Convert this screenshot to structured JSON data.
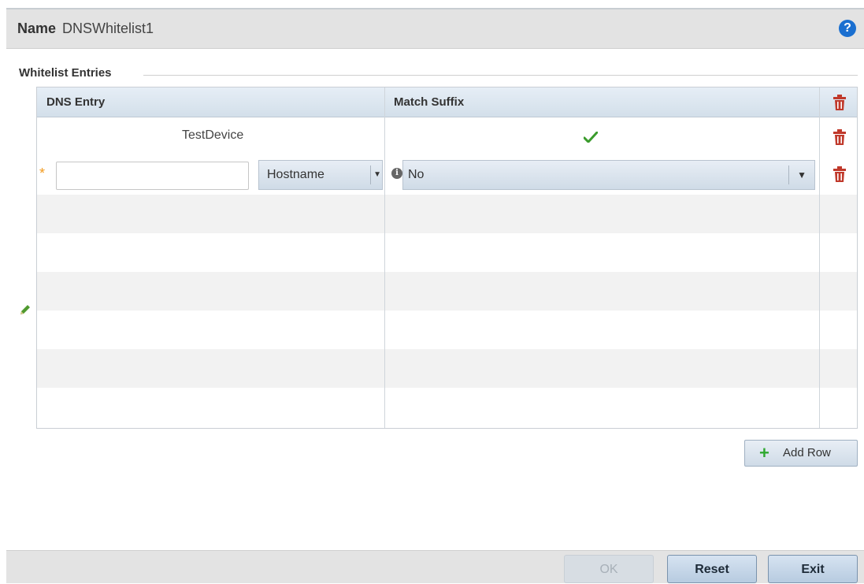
{
  "header": {
    "name_label": "Name",
    "name_value": "DNSWhitelist1",
    "help_icon": "?"
  },
  "section": {
    "title": "Whitelist Entries"
  },
  "table": {
    "columns": [
      "DNS Entry",
      "Match Suffix"
    ],
    "rows": [
      {
        "dns_entry": "TestDevice",
        "match_suffix": "checked"
      }
    ],
    "edit_row": {
      "dns_entry_value": "",
      "type_select": "Hostname",
      "match_select": "No",
      "required_mark": "*"
    }
  },
  "buttons": {
    "add_row": "Add Row",
    "ok": "OK",
    "reset": "Reset",
    "exit": "Exit"
  },
  "colors": {
    "trash": "#c0392b",
    "check": "#3a9b2c",
    "help": "#1a6fd0",
    "plus": "#2fa82f"
  }
}
